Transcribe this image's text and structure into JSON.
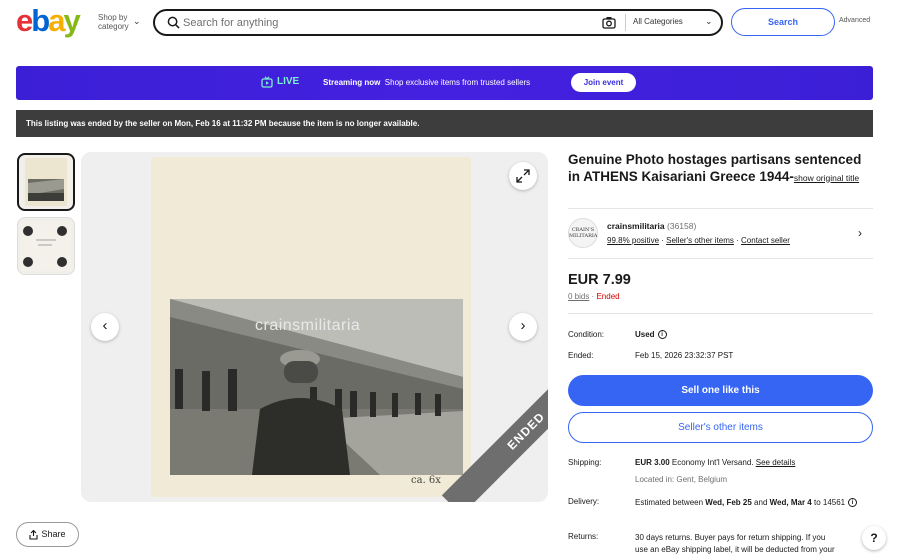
{
  "header": {
    "logo_letters": [
      "e",
      "b",
      "a",
      "y"
    ],
    "shop_by_category": "Shop by category",
    "search_placeholder": "Search for anything",
    "category_selected": "All Categories",
    "search_button": "Search",
    "advanced_link": "Advanced"
  },
  "live_banner": {
    "label": "LIVE",
    "text_bold": "Streaming now",
    "text": "Shop exclusive items from trusted sellers",
    "join_button": "Join event",
    "colors": {
      "background": "#3b1fd6",
      "label": "#7cf0d2"
    }
  },
  "notice": {
    "ended_text": "This listing was ended by the seller on Mon, Feb 16 at 11:32 PM because the item is no longer available."
  },
  "gallery": {
    "watermark": "crainsmilitaria",
    "caption": "ca. 6x",
    "ribbon": "ENDED"
  },
  "share": {
    "label": "Share"
  },
  "listing": {
    "title": "Genuine Photo hostages partisans sentenced in ATHENS Kaisariani Greece 1944-",
    "show_original": "show original title",
    "seller": {
      "logo_text": "CRAIN'S MILITARIA",
      "name": "crainsmilitaria",
      "count": "(36158)",
      "positive": "99.8% positive",
      "other_items_link": "Seller's other items",
      "contact": "Contact seller"
    },
    "price": "EUR 7.99",
    "bids": "0 bids",
    "status": "Ended",
    "condition_label": "Condition:",
    "condition_value": "Used",
    "ended_label": "Ended:",
    "ended_value": "Feb 15, 2026 23:32:37 PST",
    "sell_button": "Sell one like this",
    "other_items_button": "Seller's other items",
    "shipping": {
      "label": "Shipping:",
      "price": "EUR 3.00",
      "method": "Economy Int'l Versand.",
      "details_link": "See details",
      "location": "Located in: Gent, Belgium"
    },
    "delivery": {
      "label": "Delivery:",
      "prefix": "Estimated between",
      "start": "Wed, Feb 25",
      "and": "and",
      "end": "Wed, Mar 4",
      "to": "to",
      "postcode": "14561"
    },
    "returns": {
      "label": "Returns:",
      "line1": "30 days returns. Buyer pays for return shipping. If you",
      "line2": "use an eBay shipping label, it will be deducted from your"
    }
  },
  "help": {
    "label": "?"
  }
}
